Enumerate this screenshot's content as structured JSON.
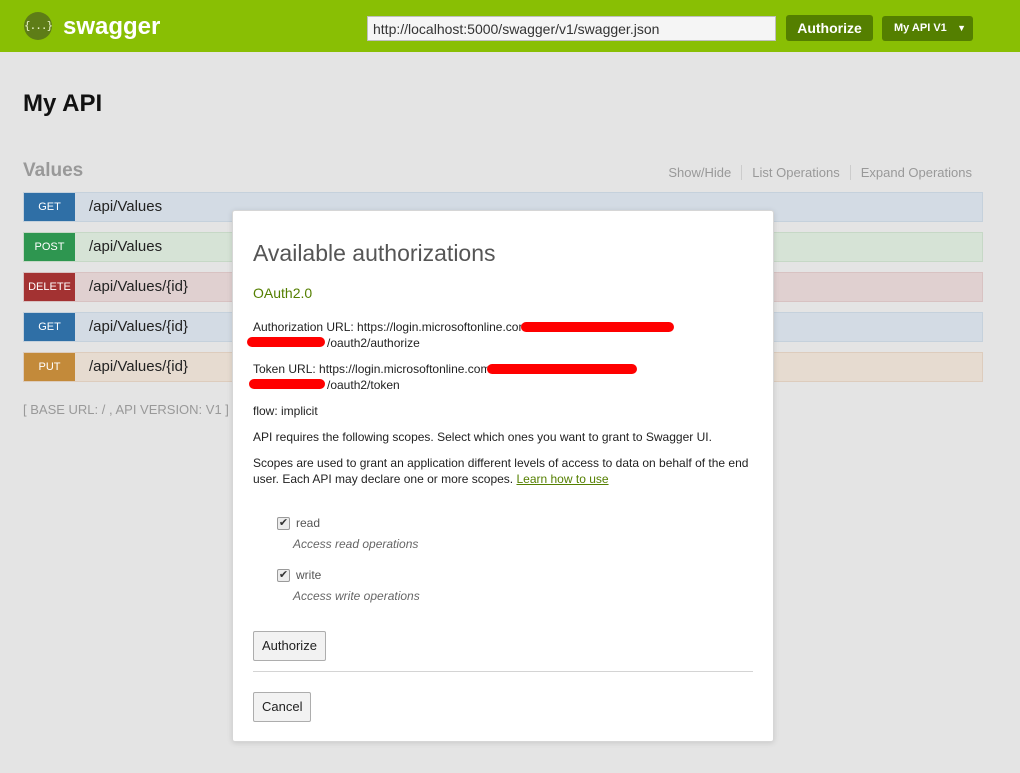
{
  "header": {
    "logo_glyph": "{...}",
    "logo_text": "swagger",
    "url_value": "http://localhost:5000/swagger/v1/swagger.json",
    "authorize_label": "Authorize",
    "api_select_value": "My API V1",
    "caret": "▼",
    "bg_color": "#89bf04",
    "button_color": "#547f00"
  },
  "page": {
    "title": "My API"
  },
  "resource": {
    "name": "Values",
    "links": [
      "Show/Hide",
      "List Operations",
      "Expand Operations"
    ],
    "operations": [
      {
        "method": "GET",
        "path": "/api/Values",
        "color": "#2f6fa6"
      },
      {
        "method": "POST",
        "path": "/api/Values",
        "color": "#2e9650"
      },
      {
        "method": "DELETE",
        "path": "/api/Values/{id}",
        "color": "#a33232"
      },
      {
        "method": "GET",
        "path": "/api/Values/{id}",
        "color": "#2f6fa6"
      },
      {
        "method": "PUT",
        "path": "/api/Values/{id}",
        "color": "#c38a3a"
      }
    ],
    "base_url": "[ BASE URL: / , API VERSION: V1 ]"
  },
  "modal": {
    "title": "Available authorizations",
    "scheme": "OAuth2.0",
    "auth_url_label": "Authorization URL: https://login.microsoftonline.com/",
    "auth_url_tail": "/oauth2/authorize",
    "token_url_label": "Token URL: https://login.microsoftonline.com/",
    "token_url_tail": "/oauth2/token",
    "flow": "flow: implicit",
    "scopes_intro": "API requires the following scopes. Select which ones you want to grant to Swagger UI.",
    "scopes_explain": "Scopes are used to grant an application different levels of access to data on behalf of the end user. Each API may declare one or more scopes.",
    "learn_link": "Learn how to use",
    "scopes": [
      {
        "name": "read",
        "description": "Access read operations",
        "checked": true
      },
      {
        "name": "write",
        "description": "Access write operations",
        "checked": true
      }
    ],
    "check_glyph": "✔",
    "authorize_label": "Authorize",
    "cancel_label": "Cancel",
    "redaction_color": "#ff0000"
  }
}
